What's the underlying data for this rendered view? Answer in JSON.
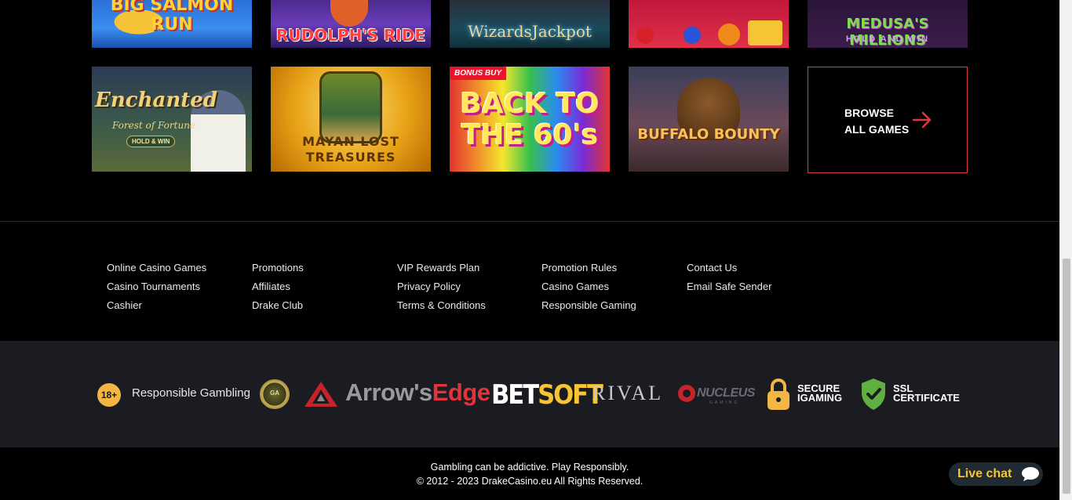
{
  "games": {
    "row1": [
      {
        "title": "BIG SALMON RUN"
      },
      {
        "title": "RUDOLPH'S RIDE"
      },
      {
        "title": "WizardsJackpot"
      },
      {
        "title": ""
      },
      {
        "title": "MEDUSA'S MILLIONS",
        "subtitle": "HOLD AND WIN"
      }
    ],
    "row2": [
      {
        "title": "Enchanted",
        "subtitle": "Forest of Fortune",
        "badge": "HOLD & WIN"
      },
      {
        "title": "MAYAN LOST TREASURES"
      },
      {
        "badge": "BONUS BUY",
        "title": "BACK TO THE 60's"
      },
      {
        "title": "BUFFALO BOUNTY"
      }
    ],
    "browse": {
      "label_line1": "BROWSE",
      "label_line2": "ALL GAMES",
      "accent": "#e0383f"
    }
  },
  "footer_links": {
    "col1": [
      "Online Casino Games",
      "Casino Tournaments",
      "Cashier"
    ],
    "col2": [
      "Promotions",
      "Affiliates",
      "Drake Club"
    ],
    "col3": [
      "VIP Rewards Plan",
      "Privacy Policy",
      "Terms & Conditions"
    ],
    "col4": [
      "Promotion Rules",
      "Casino Games",
      "Responsible Gaming"
    ],
    "col5": [
      "Contact Us",
      "Email Safe Sender"
    ]
  },
  "partners": {
    "age_badge": "18+",
    "responsible_gambling": "Responsible Gambling",
    "seal_text": "GA",
    "arrows_edge_a": "Arrow's",
    "arrows_edge_b": "Edge",
    "betsoft_a": "BET",
    "betsoft_b": "SOFT",
    "rival": "RIVAL",
    "nucleus": "NUCLEUS",
    "nucleus_sub": "GAMING",
    "secure_line1": "SECURE",
    "secure_line2": "IGAMING",
    "ssl_line1": "SSL",
    "ssl_line2": "CERTIFICATE"
  },
  "bottom": {
    "line1": "Gambling can be addictive. Play Responsibly.",
    "line2": "© 2012 - 2023 DrakeCasino.eu All Rights Reserved."
  },
  "livechat": {
    "label": "Live chat",
    "icon": "chat-bubble-icon"
  },
  "colors": {
    "accent_red": "#e0383f",
    "gold": "#f3b544",
    "band": "#1b1c22"
  }
}
